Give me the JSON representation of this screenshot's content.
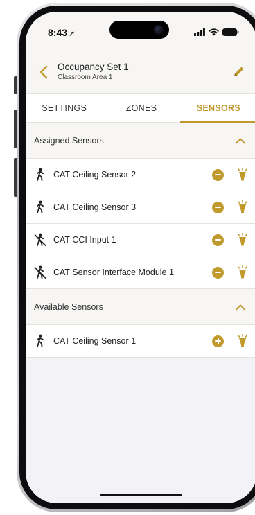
{
  "status_bar": {
    "time": "8:43",
    "location_glyph": "➚"
  },
  "header": {
    "title": "Occupancy Set 1",
    "subtitle": "Classroom Area 1"
  },
  "tabs": [
    {
      "label": "SETTINGS",
      "active": false
    },
    {
      "label": "ZONES",
      "active": false
    },
    {
      "label": "SENSORS",
      "active": true
    }
  ],
  "assigned": {
    "title": "Assigned Sensors",
    "items": [
      {
        "label": "CAT Ceiling Sensor 2",
        "icon": "walking-person-icon",
        "action": "remove"
      },
      {
        "label": "CAT Ceiling Sensor 3",
        "icon": "walking-person-icon",
        "action": "remove"
      },
      {
        "label": "CAT CCI Input 1",
        "icon": "no-motion-person-icon",
        "action": "remove"
      },
      {
        "label": "CAT Sensor Interface Module 1",
        "icon": "no-motion-person-icon",
        "action": "remove"
      }
    ]
  },
  "available": {
    "title": "Available Sensors",
    "items": [
      {
        "label": "CAT Ceiling Sensor 1",
        "icon": "walking-person-icon",
        "action": "add"
      }
    ]
  },
  "colors": {
    "accent": "#c19a2e",
    "header_bg": "#f7f6f4",
    "screen_bg": "#f2f2f7"
  }
}
